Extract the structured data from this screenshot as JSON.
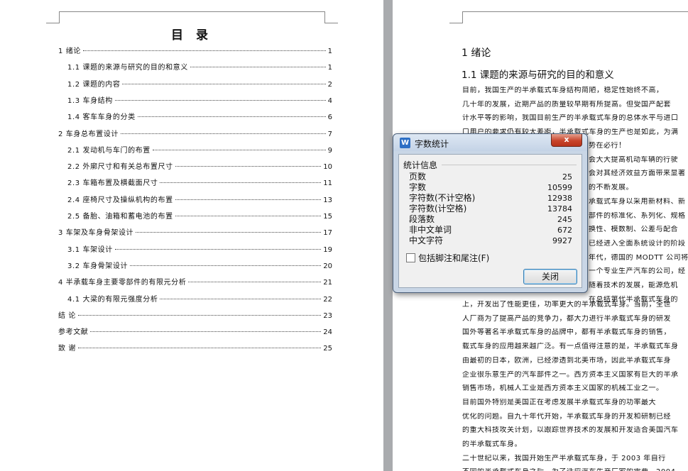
{
  "left_page": {
    "toc_title": "目 录",
    "entries": [
      {
        "text": "1 绪论",
        "page": "1"
      },
      {
        "text": "1.1 课题的来源与研究的目的和意义",
        "page": "1"
      },
      {
        "text": "1.2 课题的内容",
        "page": "2"
      },
      {
        "text": "1.3 车身结构",
        "page": "4"
      },
      {
        "text": "1.4 客车车身的分类",
        "page": "6"
      },
      {
        "text": "2 车身总布置设计",
        "page": "7"
      },
      {
        "text": "2.1 发动机与车门的布置",
        "page": "9"
      },
      {
        "text": "2.2 外廓尺寸和有关总布置尺寸",
        "page": "10"
      },
      {
        "text": "2.3 车箱布置及横截面尺寸",
        "page": "11"
      },
      {
        "text": "2.4 座椅尺寸及操纵机构的布置",
        "page": "13"
      },
      {
        "text": "2.5 备胎、油箱和蓄电池的布置",
        "page": "15"
      },
      {
        "text": "3 车架及车身骨架设计",
        "page": "17"
      },
      {
        "text": "3.1 车架设计",
        "page": "19"
      },
      {
        "text": "3.2 车身骨架设计",
        "page": "20"
      },
      {
        "text": "4 半承载车身主要零部件的有限元分析",
        "page": "21"
      },
      {
        "text": "4.1 大梁的有限元强度分析",
        "page": "22"
      },
      {
        "text": "结   论",
        "page": "23"
      },
      {
        "text": "参考文献",
        "page": "24"
      },
      {
        "text": "致   谢",
        "page": "25"
      }
    ]
  },
  "right_page": {
    "heading1": "1 绪论",
    "heading2": "1.1 课题的来源与研究的目的和意义",
    "lines_top": [
      "      目前，我国生产的半承载式车身结构简陋，稳定性始终不高，",
      "几十年的发展，近期产品的质量较早期有所提高。但受国产配套",
      "计水平等的影响，我国目前生产的半承载式车身的总体水平与进口",
      "口用户的要求仍有较大差距，半承载式车身的生产也是如此，为满"
    ],
    "lines_right": [
      "势在必行！",
      "会大大提高机动车辆的行驶",
      "会对其经济效益方面带来显著",
      "的不断发展。",
      "承载式车身以采用新材料、新",
      "部件的标准化、系列化、规格",
      "换性、模数制、公差与配合",
      "已经进入全面系统设计的阶段",
      "年代，德国的 MODTT 公司将",
      "一个专业生产汽车的公司，经",
      "随着技术的发展，能源危机",
      "在总结第代半承载式车身的"
    ],
    "lines_bottom": [
      "上，开发出了性能更佳，功率更大的半承载式车身。当前，全世",
      "人厂商为了提高产品的竞争力，都大力进行半承载式车身的研发",
      "国外等著名半承载式车身的品牌中，都有半承载式车身的销售，",
      "载式车身的应用越来越广泛。有一点值得注意的是，半承载式车身",
      "由最初的日本，欧洲，已经渗透到北美市场，因此半承载式车身",
      "企业很乐意生产的汽车部件之一。西方资本主义国家有巨大的半承",
      "销售市场，机械人工业是西方资本主义国家的机械工业之一。",
      "      目前国外特别是美国正在考虑发展半承载式车身的功率最大",
      "优化的问题。自九十年代开始，半承载式车身的开发和研制已经",
      "的重大科技攻关计划，以跟踪世界技术的发展和开发适合美国汽车",
      "的半承载式车身。",
      "      二十世纪以来，我国开始生产半承载式车身，于 2003 年自行",
      "不同的半承载式车身之后，为了适应汽车生产厂家的需要，2004"
    ]
  },
  "dialog": {
    "title": "字数统计",
    "close_label": "x",
    "group_label": "统计信息",
    "stats": [
      {
        "label": "页数",
        "value": "25"
      },
      {
        "label": "字数",
        "value": "10599"
      },
      {
        "label": "字符数(不计空格)",
        "value": "12938"
      },
      {
        "label": "字符数(计空格)",
        "value": "13784"
      },
      {
        "label": "段落数",
        "value": "245"
      },
      {
        "label": "非中文单词",
        "value": "672"
      },
      {
        "label": "中文字符",
        "value": "9927"
      }
    ],
    "checkbox_label": "包括脚注和尾注(F)",
    "checkbox_checked": false,
    "ok_label": "关闭"
  }
}
